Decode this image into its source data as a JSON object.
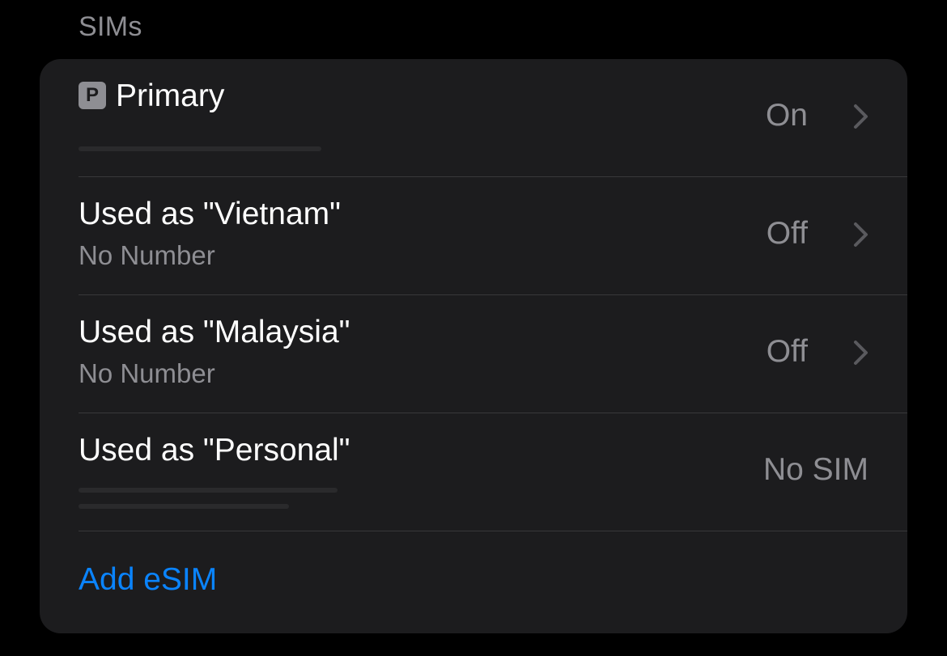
{
  "section": {
    "header": "SIMs"
  },
  "sims": [
    {
      "badge": "P",
      "title": "Primary",
      "subtitle": "",
      "value": "On",
      "chevron": true
    },
    {
      "title": "Used as \"Vietnam\"",
      "subtitle": "No Number",
      "value": "Off",
      "chevron": true
    },
    {
      "title": "Used as \"Malaysia\"",
      "subtitle": "No Number",
      "value": "Off",
      "chevron": true
    },
    {
      "title": "Used as \"Personal\"",
      "subtitle": "",
      "value": "No SIM",
      "chevron": false
    }
  ],
  "actions": {
    "add_esim": "Add eSIM"
  },
  "colors": {
    "background": "#000000",
    "card": "#1c1c1e",
    "primary_text": "#ffffff",
    "secondary_text": "#8e8e93",
    "accent": "#0a84ff",
    "separator": "#38383a"
  },
  "icons": {
    "row_chevron": "chevron-right-icon",
    "primary_badge": "primary-sim-badge-icon"
  }
}
